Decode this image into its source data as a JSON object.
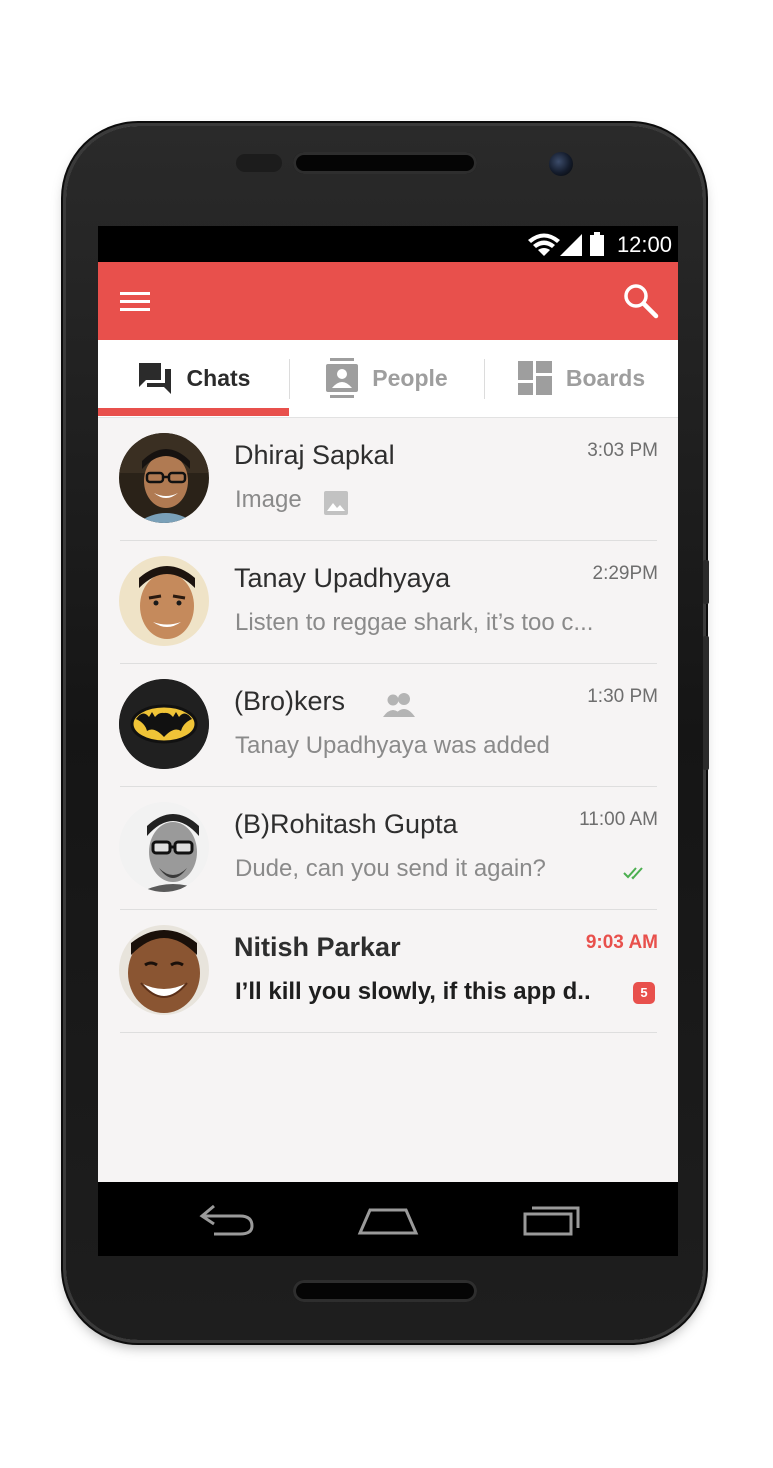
{
  "status_bar": {
    "time": "12:00"
  },
  "app_bar": {
    "menu_icon": "menu-icon",
    "search_icon": "search-icon"
  },
  "tabs": [
    {
      "label": "Chats",
      "icon": "chat-icon",
      "active": true
    },
    {
      "label": "People",
      "icon": "contact-card-icon",
      "active": false
    },
    {
      "label": "Boards",
      "icon": "dashboard-icon",
      "active": false
    }
  ],
  "chats": [
    {
      "name": "Dhiraj Sapkal",
      "time": "3:03 PM",
      "preview": "Image",
      "preview_icon": "image-icon",
      "unread": false
    },
    {
      "name": "Tanay Upadhyaya",
      "time": "2:29PM",
      "preview": "Listen to reggae shark, it’s too c...",
      "unread": false
    },
    {
      "name": "(Bro)kers",
      "time": "1:30 PM",
      "preview": "Tanay Upadhyaya was added",
      "name_icon": "group-icon",
      "unread": false
    },
    {
      "name": "(B)Rohitash Gupta",
      "time": "11:00 AM",
      "preview": "Dude, can you send it again?",
      "status_icon": "double-check-icon",
      "unread": false
    },
    {
      "name": "Nitish Parkar",
      "time": "9:03 AM",
      "preview": "I’ll kill you slowly, if this app d..",
      "unread": true,
      "unread_count": "5"
    }
  ],
  "fab": {
    "icon": "new-chat-icon"
  },
  "colors": {
    "accent": "#e8504c",
    "background": "#f6f4f4",
    "read_check": "#4caf50"
  }
}
